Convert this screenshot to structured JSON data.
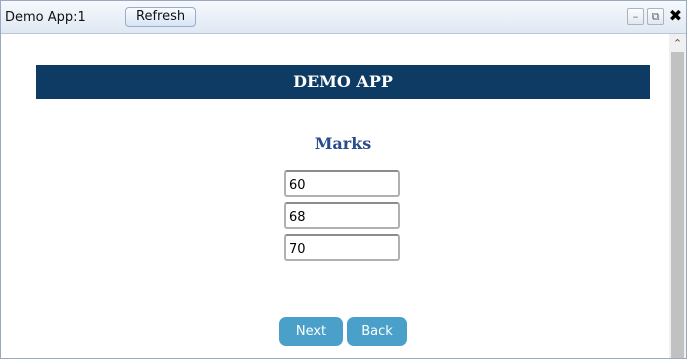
{
  "window": {
    "title": "Demo App:1",
    "refresh_label": "Refresh",
    "controls": {
      "minimize_icon": "minimize-icon",
      "popout_icon": "popout-icon",
      "close_icon": "close-icon"
    }
  },
  "main": {
    "banner": "DEMO APP",
    "section_title": "Marks",
    "marks": [
      "60",
      "68",
      "70"
    ],
    "next_label": "Next",
    "back_label": "Back"
  },
  "colors": {
    "banner_bg": "#0d3b63",
    "section_title": "#2a4b8d",
    "button_bg": "#4aa0c8"
  }
}
